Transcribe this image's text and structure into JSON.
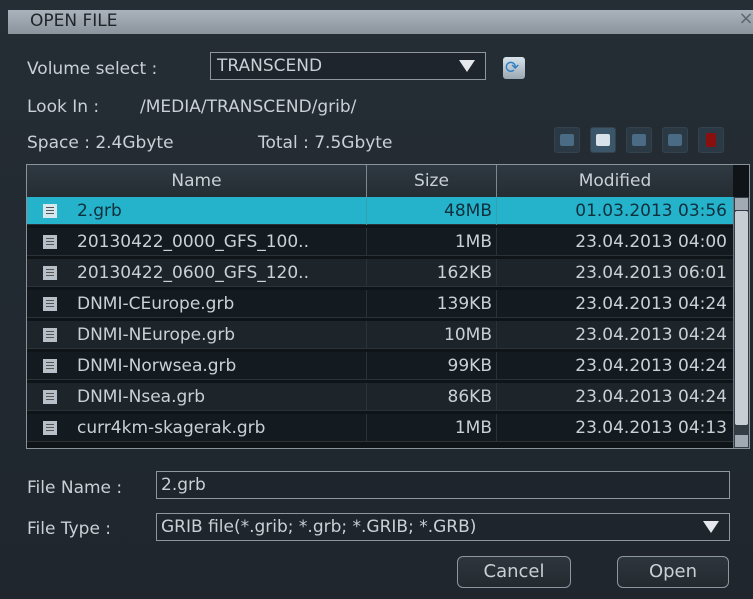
{
  "window": {
    "title": "OPEN FILE",
    "close_symbol": "×"
  },
  "volume": {
    "label": "Volume select :",
    "selected": "TRANSCEND"
  },
  "look_in": {
    "label": "Look In :",
    "path": "/MEDIA/TRANSCEND/grib/"
  },
  "space": {
    "label": "Space : 2.4Gbyte",
    "total": "Total : 7.5Gbyte"
  },
  "toolbar": {
    "icons": [
      "folder-up-icon",
      "upload-icon",
      "folder-icon",
      "list-icon",
      "delete-icon"
    ]
  },
  "table": {
    "columns": [
      "Name",
      "Size",
      "Modified"
    ],
    "rows": [
      {
        "name": "2.grb",
        "size": "48MB",
        "modified": "01.03.2013 03:56"
      },
      {
        "name": "20130422_0000_GFS_100..",
        "size": "1MB",
        "modified": "23.04.2013 04:00"
      },
      {
        "name": "20130422_0600_GFS_120..",
        "size": "162KB",
        "modified": "23.04.2013 06:01"
      },
      {
        "name": "DNMI-CEurope.grb",
        "size": "139KB",
        "modified": "23.04.2013 04:24"
      },
      {
        "name": "DNMI-NEurope.grb",
        "size": "10MB",
        "modified": "23.04.2013 04:24"
      },
      {
        "name": "DNMI-Norwsea.grb",
        "size": "99KB",
        "modified": "23.04.2013 04:24"
      },
      {
        "name": "DNMI-Nsea.grb",
        "size": "86KB",
        "modified": "23.04.2013 04:24"
      },
      {
        "name": "curr4km-skagerak.grb",
        "size": "1MB",
        "modified": "23.04.2013 04:13"
      }
    ],
    "selected_index": 0
  },
  "file_name": {
    "label": "File Name :",
    "value": "2.grb"
  },
  "file_type": {
    "label": "File Type :",
    "value": "GRIB file(*.grib; *.grb; *.GRIB; *.GRB)"
  },
  "buttons": {
    "cancel": "Cancel",
    "open": "Open"
  },
  "colors": {
    "selection": "#25b2cb",
    "background": "#1f262d",
    "text": "#c9d0d6"
  }
}
